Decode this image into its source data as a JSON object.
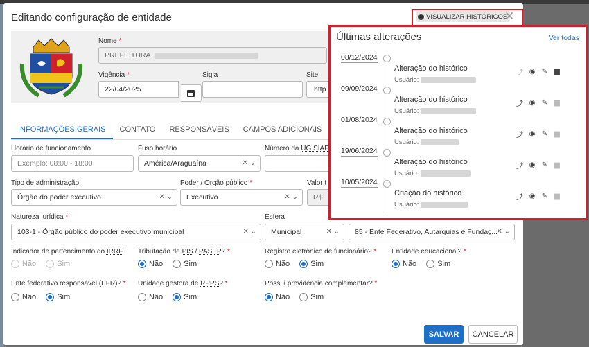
{
  "modal": {
    "title": "Editando configuração de entidade",
    "history_button": "VISUALIZAR HISTÓRICOS",
    "close_glyph": "✕"
  },
  "header": {
    "nome_label": "Nome",
    "nome_value": "PREFEITURA",
    "vigencia_label": "Vigência",
    "vigencia_value": "22/04/2025",
    "sigla_label": "Sigla",
    "sigla_value": "",
    "site_label": "Site",
    "site_value": "http"
  },
  "tabs": [
    "INFORMAÇÕES GERAIS",
    "CONTATO",
    "RESPONSÁVEIS",
    "CAMPOS ADICIONAIS"
  ],
  "fields": {
    "horario_label": "Horário de funcionamento",
    "horario_placeholder": "Exemplo: 08:00 - 18:00",
    "fuso_label": "Fuso horário",
    "fuso_value": "América/Araguaína",
    "ug_label_prefix": "Número da ",
    "ug_label_link": "UG SIAFI",
    "tipo_label": "Tipo de administração",
    "tipo_value": "Órgão do poder executivo",
    "poder_label": "Poder / Órgão público",
    "poder_value": "Executivo",
    "valor_label": "Valor t",
    "valor_prefix": "R$",
    "natureza_label": "Natureza jurídica",
    "natureza_value": "103-1 - Órgão público do poder executivo municipal",
    "esfera_label": "Esfera",
    "esfera_value": "Municipal",
    "ente_value": "85 - Ente Federativo, Autarquias e Fundaç..."
  },
  "radios": {
    "irrf_label_prefix": "Indicador de pertencimento do ",
    "irrf_label_link": "IRRF",
    "pis_label_prefix": "Tributação de ",
    "pis_label_link1": "PIS",
    "pis_label_sep": " / ",
    "pis_label_link2": "PASEP",
    "pis_label_suffix": "?",
    "registro_label": "Registro eletrônico de funcionário?",
    "educacional_label": "Entidade educacional?",
    "efr_label": "Ente federativo responsável (EFR)?",
    "rpps_label_prefix": "Unidade gestora de ",
    "rpps_label_link": "RPPS",
    "rpps_label_suffix": "?",
    "previdencia_label": "Possui previdência complementar?",
    "nao": "Não",
    "sim": "Sim",
    "required_mark": "*"
  },
  "footer": {
    "save": "SALVAR",
    "cancel": "CANCELAR"
  },
  "history": {
    "title": "Últimas alterações",
    "see_all": "Ver todas",
    "user_label": "Usuário:",
    "items": [
      {
        "date": "08/12/2024",
        "title": "Alteração do histórico"
      },
      {
        "date": "09/09/2024",
        "title": "Alteração do histórico"
      },
      {
        "date": "01/08/2024",
        "title": "Alteração do histórico"
      },
      {
        "date": "19/06/2024",
        "title": "Alteração do histórico"
      },
      {
        "date": "10/05/2024",
        "title": "Criação do histórico"
      }
    ]
  },
  "colors": {
    "accent": "#1e6fc8",
    "highlight": "#d0202b"
  }
}
